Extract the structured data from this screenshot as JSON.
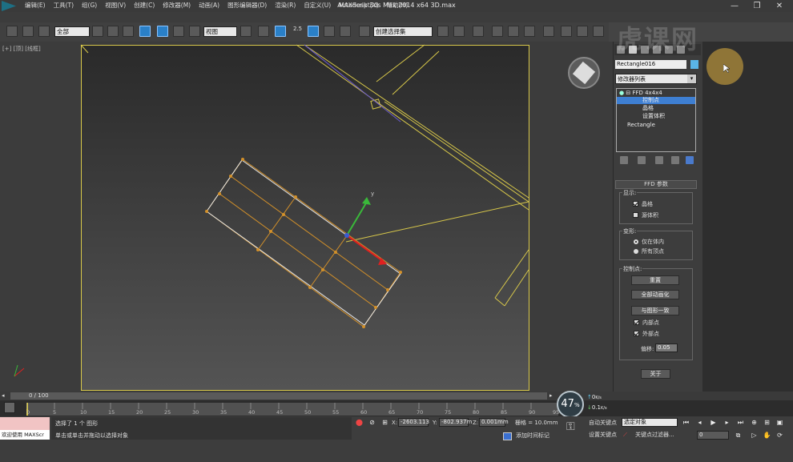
{
  "window": {
    "title": "Autodesk 3ds Max  2014 x64     3D.max",
    "minimize": "—",
    "restore": "❐",
    "close": "✕"
  },
  "menu": [
    "编辑(E)",
    "工具(T)",
    "组(G)",
    "视图(V)",
    "创建(C)",
    "修改器(M)",
    "动画(A)",
    "图形编辑器(D)",
    "渲染(R)",
    "自定义(U)",
    "MAXScript(X)",
    "帮助(H)"
  ],
  "toolbar": {
    "filter": "全部",
    "refcoord": "视图",
    "snap_angle": "2.5",
    "named_selection": "创建选择集"
  },
  "viewport": {
    "label": "[+] [顶] [线框]"
  },
  "command_panel": {
    "object_name": "Rectangle016",
    "modifier_list": "修改器列表",
    "stack": [
      {
        "label": "FFD 4x4x4"
      },
      {
        "label": "控制点"
      },
      {
        "label": "晶格"
      },
      {
        "label": "设置体积"
      },
      {
        "label": "Rectangle"
      }
    ],
    "rollout_title": "FFD 参数",
    "display_group": "显示:",
    "display_lattice": "晶格",
    "display_source_volume": "源体积",
    "deform_group": "变形:",
    "deform_only_in_volume": "仅在体内",
    "deform_all_vertices": "所有顶点",
    "cp_group": "控制点:",
    "reset_btn": "重置",
    "animate_all_btn": "全部动画化",
    "conform_btn": "与图形一致",
    "inside_points": "内部点",
    "outside_points": "外部点",
    "offset_label": "偏移:",
    "offset_value": "0.05",
    "about_btn": "关于"
  },
  "timeline": {
    "frame": "0 / 100",
    "ticks": [
      "0",
      "5",
      "10",
      "15",
      "20",
      "25",
      "30",
      "35",
      "40",
      "45",
      "50",
      "55",
      "60",
      "65",
      "70",
      "75",
      "80",
      "85",
      "90",
      "95"
    ]
  },
  "perf": {
    "fps": "47",
    "fps_unit": "%",
    "up": "0",
    "up_unit": "K/s",
    "down": "0.1",
    "down_unit": "K/s"
  },
  "status": {
    "welcome": "欢迎使用 MAXScr",
    "selection": "选择了 1 个 图形",
    "prompt": "单击或单击并拖动以选择对象",
    "x_label": "X:",
    "x": "-2603.113",
    "y_label": "Y:",
    "y": "-802.937m",
    "z_label": "Z:",
    "z": "0.001mm",
    "grid": "栅格 = 10.0mm",
    "add_time_tag": "添加时间标记",
    "auto_key": "自动关键点",
    "selected_object": "选定对象",
    "set_key": "设置关键点",
    "key_filters": "关键点过滤器...",
    "current_frame": "0"
  },
  "watermark": "虎课网"
}
